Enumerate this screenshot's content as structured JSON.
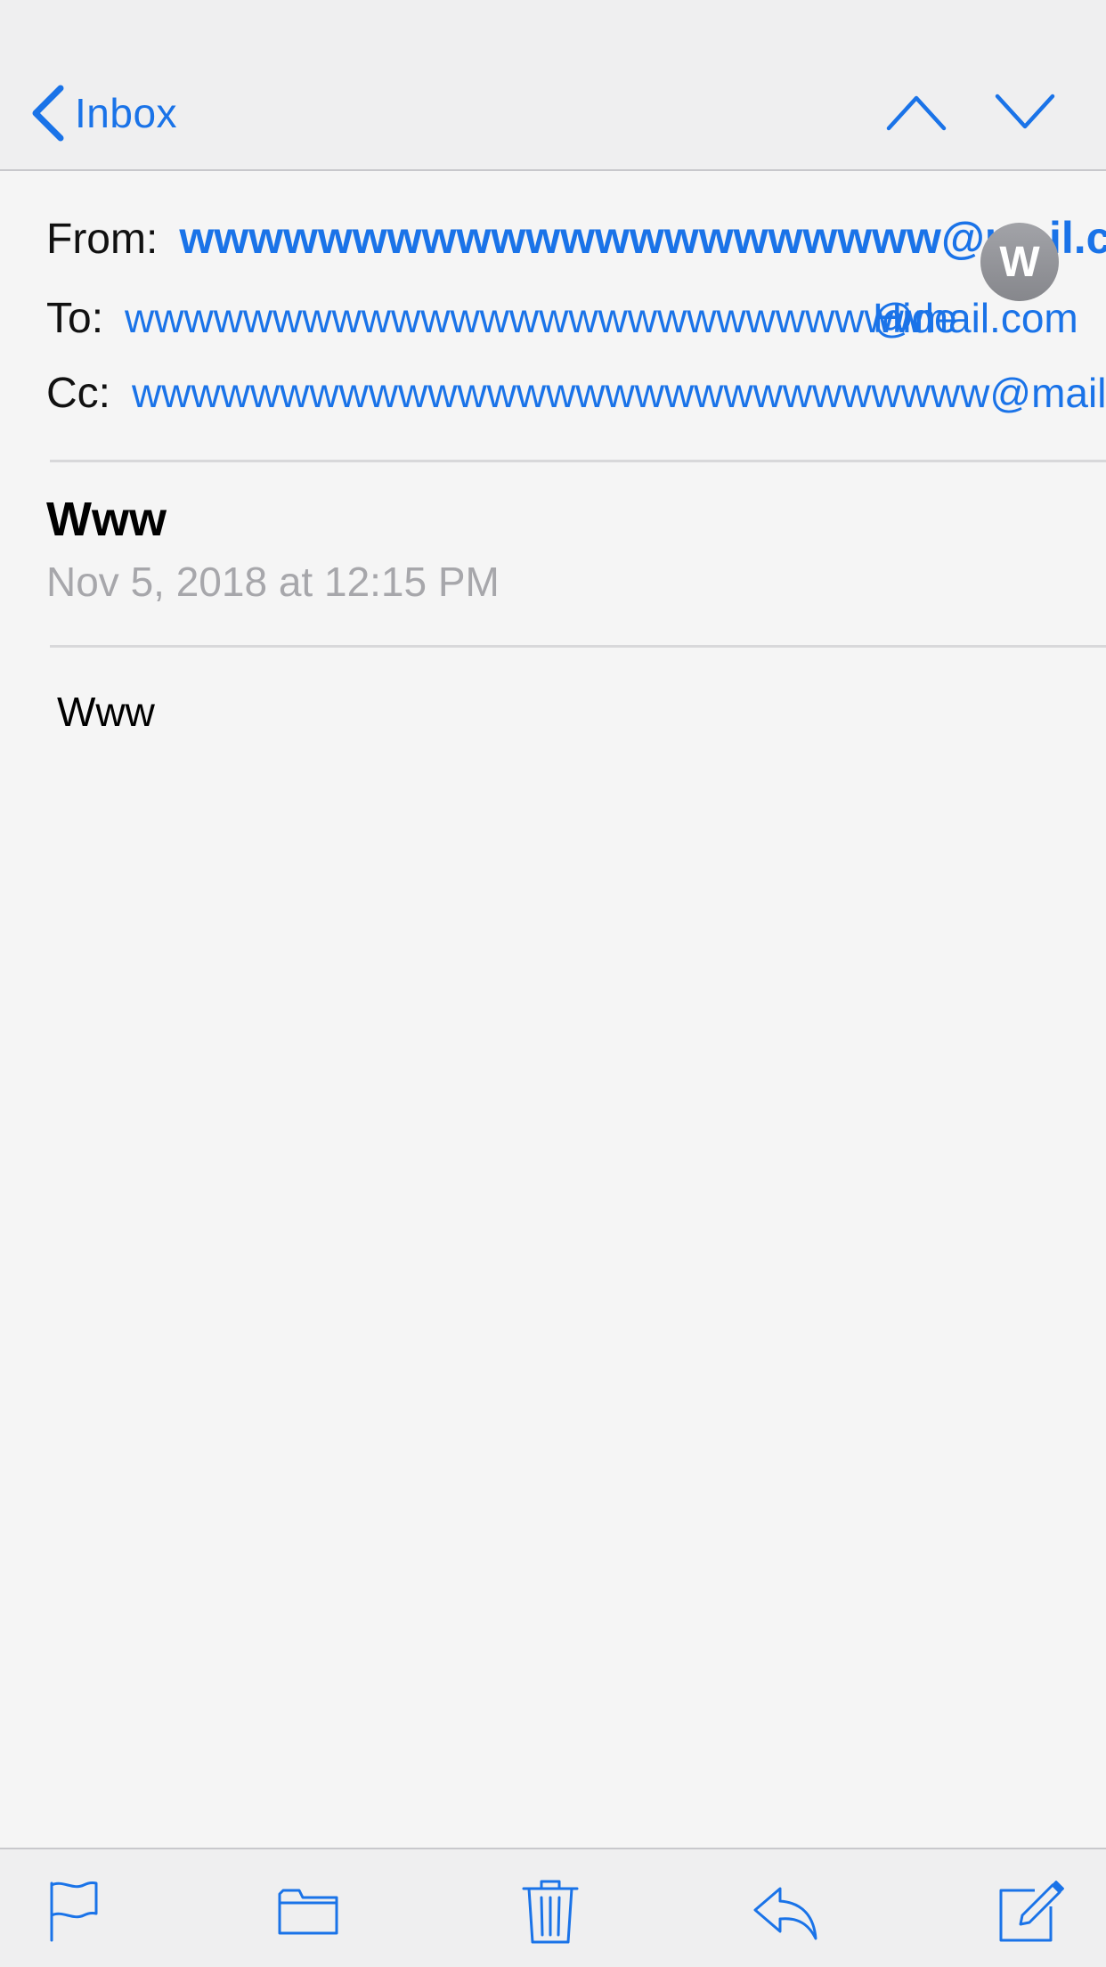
{
  "navbar": {
    "back_label": "Inbox",
    "back_icon": "chevron-left-icon",
    "prev_icon": "chevron-up-icon",
    "next_icon": "chevron-down-icon"
  },
  "header": {
    "from_label": "From:",
    "from_value": "wwwwwwwwwwwwwwwwwwwwww@mail.c",
    "to_label": "To:",
    "to_value": "wwwwwwwwwwwwwwwwwwwwwwwwwww",
    "to_value_end": "@mail.com",
    "hide_label": "Hide",
    "cc_label": "Cc:",
    "cc_value": "wwwwwwwwwwwwwwwwwwwwwwwwwwwww@mail.c",
    "avatar_initial": "W"
  },
  "message": {
    "subject": "Www",
    "date": "Nov 5, 2018 at 12:15 PM",
    "body": "Www"
  },
  "toolbar": {
    "icons": [
      "flag-icon",
      "folder-icon",
      "trash-icon",
      "reply-icon",
      "compose-icon"
    ]
  },
  "colors": {
    "accent": "#1a73e8",
    "background": "#f5f5f5",
    "bar": "#efeff0",
    "secondary_text": "#a7a7ab"
  }
}
